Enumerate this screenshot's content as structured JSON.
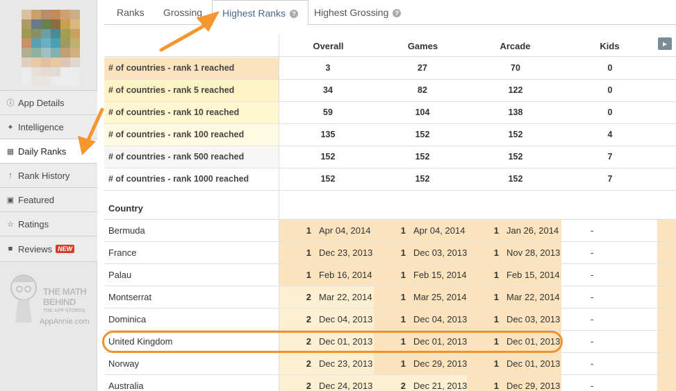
{
  "sidebar": {
    "items": [
      {
        "label": "App Details",
        "icon": "info-icon"
      },
      {
        "label": "Intelligence",
        "icon": "wand-icon"
      },
      {
        "label": "Daily Ranks",
        "icon": "calendar-icon"
      },
      {
        "label": "Rank History",
        "icon": "arrow-up-icon"
      },
      {
        "label": "Featured",
        "icon": "featured-icon"
      },
      {
        "label": "Ratings",
        "icon": "star-icon"
      },
      {
        "label": "Reviews",
        "icon": "chat-icon",
        "badge": "NEW"
      }
    ],
    "promo": {
      "line1": "THE MATH",
      "line2": "BEHIND",
      "line3": "THE APP STORES",
      "site": "AppAnnie.com"
    }
  },
  "tabs": [
    {
      "label": "Ranks"
    },
    {
      "label": "Grossing"
    },
    {
      "label": "Highest Ranks",
      "active": true
    },
    {
      "label": "Highest Grossing"
    }
  ],
  "columns": [
    "Overall",
    "Games",
    "Arcade",
    "Kids"
  ],
  "summary": [
    {
      "label": "# of countries - rank 1 reached",
      "values": [
        "3",
        "27",
        "70",
        "0"
      ]
    },
    {
      "label": "# of countries - rank 5 reached",
      "values": [
        "34",
        "82",
        "122",
        "0"
      ]
    },
    {
      "label": "# of countries - rank 10 reached",
      "values": [
        "59",
        "104",
        "138",
        "0"
      ]
    },
    {
      "label": "# of countries - rank 100 reached",
      "values": [
        "135",
        "152",
        "152",
        "4"
      ]
    },
    {
      "label": "# of countries - rank 500 reached",
      "values": [
        "152",
        "152",
        "152",
        "7"
      ]
    },
    {
      "label": "# of countries - rank 1000 reached",
      "values": [
        "152",
        "152",
        "152",
        "7"
      ]
    }
  ],
  "country_header": "Country",
  "countries": [
    {
      "name": "Bermuda",
      "cells": [
        {
          "rank": "1",
          "date": "Apr 04, 2014"
        },
        {
          "rank": "1",
          "date": "Apr 04, 2014"
        },
        {
          "rank": "1",
          "date": "Jan 26, 2014"
        }
      ],
      "kids": "-"
    },
    {
      "name": "France",
      "cells": [
        {
          "rank": "1",
          "date": "Dec 23, 2013"
        },
        {
          "rank": "1",
          "date": "Dec 03, 2013"
        },
        {
          "rank": "1",
          "date": "Nov 28, 2013"
        }
      ],
      "kids": "-"
    },
    {
      "name": "Palau",
      "cells": [
        {
          "rank": "1",
          "date": "Feb 16, 2014"
        },
        {
          "rank": "1",
          "date": "Feb 15, 2014"
        },
        {
          "rank": "1",
          "date": "Feb 15, 2014"
        }
      ],
      "kids": "-"
    },
    {
      "name": "Montserrat",
      "cells": [
        {
          "rank": "2",
          "date": "Mar 22, 2014"
        },
        {
          "rank": "1",
          "date": "Mar 25, 2014"
        },
        {
          "rank": "1",
          "date": "Mar 22, 2014"
        }
      ],
      "kids": "-"
    },
    {
      "name": "Dominica",
      "cells": [
        {
          "rank": "2",
          "date": "Dec 04, 2013"
        },
        {
          "rank": "1",
          "date": "Dec 04, 2013"
        },
        {
          "rank": "1",
          "date": "Dec 03, 2013"
        }
      ],
      "kids": "-"
    },
    {
      "name": "United Kingdom",
      "cells": [
        {
          "rank": "2",
          "date": "Dec 01, 2013"
        },
        {
          "rank": "1",
          "date": "Dec 01, 2013"
        },
        {
          "rank": "1",
          "date": "Dec 01, 2013"
        }
      ],
      "kids": "-"
    },
    {
      "name": "Norway",
      "cells": [
        {
          "rank": "2",
          "date": "Dec 23, 2013"
        },
        {
          "rank": "1",
          "date": "Dec 29, 2013"
        },
        {
          "rank": "1",
          "date": "Dec 01, 2013"
        }
      ],
      "kids": "-"
    },
    {
      "name": "Australia",
      "cells": [
        {
          "rank": "2",
          "date": "Dec 24, 2013"
        },
        {
          "rank": "2",
          "date": "Dec 21, 2013"
        },
        {
          "rank": "1",
          "date": "Dec 29, 2013"
        }
      ],
      "kids": "-"
    }
  ],
  "colors": {
    "rank1": "#fbe3bd",
    "rank2": "#fdf0d2",
    "rank5": "#fdf3c4",
    "rank10": "#fef7d0",
    "rank100": "#fefbe2",
    "highlight": "#f0902a",
    "arrow": "#f5962e"
  }
}
